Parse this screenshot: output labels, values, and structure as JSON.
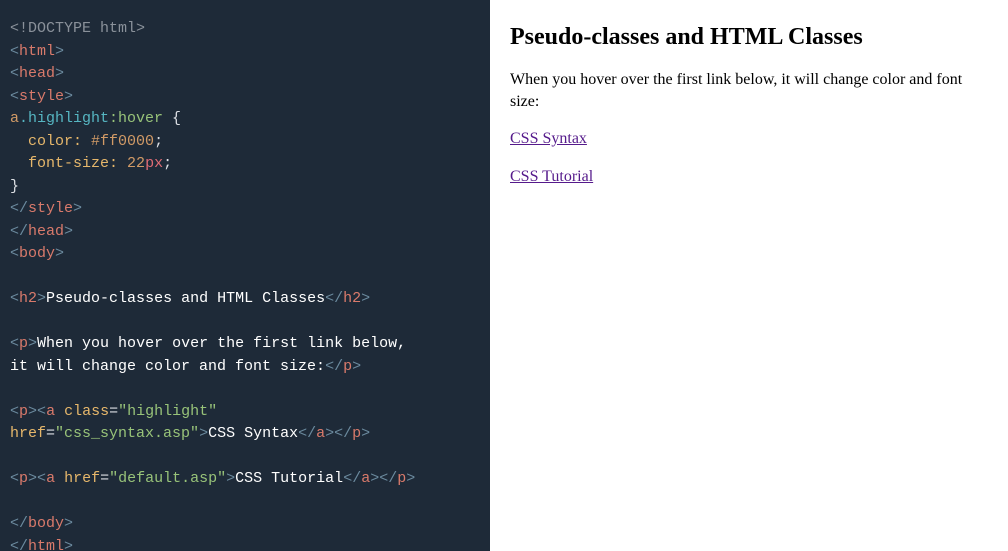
{
  "code": {
    "lines": [
      [
        {
          "cls": "c-gray",
          "t": "<!DOCTYPE html>"
        }
      ],
      [
        {
          "cls": "c-bracket",
          "t": "<"
        },
        {
          "cls": "c-tag",
          "t": "html"
        },
        {
          "cls": "c-bracket",
          "t": ">"
        }
      ],
      [
        {
          "cls": "c-bracket",
          "t": "<"
        },
        {
          "cls": "c-tag",
          "t": "head"
        },
        {
          "cls": "c-bracket",
          "t": ">"
        }
      ],
      [
        {
          "cls": "c-bracket",
          "t": "<"
        },
        {
          "cls": "c-tag",
          "t": "style"
        },
        {
          "cls": "c-bracket",
          "t": ">"
        }
      ],
      [
        {
          "cls": "c-seltag",
          "t": "a"
        },
        {
          "cls": "c-class",
          "t": ".highlight"
        },
        {
          "cls": "c-pseudo",
          "t": ":hover"
        },
        {
          "cls": "c-white",
          "t": " {"
        }
      ],
      [
        {
          "cls": "c-white",
          "t": "  "
        },
        {
          "cls": "c-prop",
          "t": "color:"
        },
        {
          "cls": "c-white",
          "t": " "
        },
        {
          "cls": "c-val",
          "t": "#ff0000"
        },
        {
          "cls": "c-white",
          "t": ";"
        }
      ],
      [
        {
          "cls": "c-white",
          "t": "  "
        },
        {
          "cls": "c-prop",
          "t": "font-size:"
        },
        {
          "cls": "c-white",
          "t": " "
        },
        {
          "cls": "c-val",
          "t": "22"
        },
        {
          "cls": "c-unit",
          "t": "px"
        },
        {
          "cls": "c-white",
          "t": ";"
        }
      ],
      [
        {
          "cls": "c-white",
          "t": "}"
        }
      ],
      [
        {
          "cls": "c-bracket",
          "t": "</"
        },
        {
          "cls": "c-tag",
          "t": "style"
        },
        {
          "cls": "c-bracket",
          "t": ">"
        }
      ],
      [
        {
          "cls": "c-bracket",
          "t": "</"
        },
        {
          "cls": "c-tag",
          "t": "head"
        },
        {
          "cls": "c-bracket",
          "t": ">"
        }
      ],
      [
        {
          "cls": "c-bracket",
          "t": "<"
        },
        {
          "cls": "c-tag",
          "t": "body"
        },
        {
          "cls": "c-bracket",
          "t": ">"
        }
      ],
      [
        {
          "cls": "",
          "t": " "
        }
      ],
      [
        {
          "cls": "c-bracket",
          "t": "<"
        },
        {
          "cls": "c-tag",
          "t": "h2"
        },
        {
          "cls": "c-bracket",
          "t": ">"
        },
        {
          "cls": "c-text",
          "t": "Pseudo-classes and HTML Classes"
        },
        {
          "cls": "c-bracket",
          "t": "</"
        },
        {
          "cls": "c-tag",
          "t": "h2"
        },
        {
          "cls": "c-bracket",
          "t": ">"
        }
      ],
      [
        {
          "cls": "",
          "t": " "
        }
      ],
      [
        {
          "cls": "c-bracket",
          "t": "<"
        },
        {
          "cls": "c-tag",
          "t": "p"
        },
        {
          "cls": "c-bracket",
          "t": ">"
        },
        {
          "cls": "c-text",
          "t": "When you hover over the first link below,"
        }
      ],
      [
        {
          "cls": "c-text",
          "t": "it will change color and font size:"
        },
        {
          "cls": "c-bracket",
          "t": "</"
        },
        {
          "cls": "c-tag",
          "t": "p"
        },
        {
          "cls": "c-bracket",
          "t": ">"
        }
      ],
      [
        {
          "cls": "",
          "t": " "
        }
      ],
      [
        {
          "cls": "c-bracket",
          "t": "<"
        },
        {
          "cls": "c-tag",
          "t": "p"
        },
        {
          "cls": "c-bracket",
          "t": ">"
        },
        {
          "cls": "c-bracket",
          "t": "<"
        },
        {
          "cls": "c-tag",
          "t": "a "
        },
        {
          "cls": "c-prop",
          "t": "class"
        },
        {
          "cls": "c-white",
          "t": "="
        },
        {
          "cls": "c-str",
          "t": "\"highlight\""
        }
      ],
      [
        {
          "cls": "c-prop",
          "t": "href"
        },
        {
          "cls": "c-white",
          "t": "="
        },
        {
          "cls": "c-str",
          "t": "\"css_syntax.asp\""
        },
        {
          "cls": "c-bracket",
          "t": ">"
        },
        {
          "cls": "c-text",
          "t": "CSS Syntax"
        },
        {
          "cls": "c-bracket",
          "t": "</"
        },
        {
          "cls": "c-tag",
          "t": "a"
        },
        {
          "cls": "c-bracket",
          "t": ">"
        },
        {
          "cls": "c-bracket",
          "t": "</"
        },
        {
          "cls": "c-tag",
          "t": "p"
        },
        {
          "cls": "c-bracket",
          "t": ">"
        }
      ],
      [
        {
          "cls": "",
          "t": " "
        }
      ],
      [
        {
          "cls": "c-bracket",
          "t": "<"
        },
        {
          "cls": "c-tag",
          "t": "p"
        },
        {
          "cls": "c-bracket",
          "t": ">"
        },
        {
          "cls": "c-bracket",
          "t": "<"
        },
        {
          "cls": "c-tag",
          "t": "a "
        },
        {
          "cls": "c-prop",
          "t": "href"
        },
        {
          "cls": "c-white",
          "t": "="
        },
        {
          "cls": "c-str",
          "t": "\"default.asp\""
        },
        {
          "cls": "c-bracket",
          "t": ">"
        },
        {
          "cls": "c-text",
          "t": "CSS Tutorial"
        },
        {
          "cls": "c-bracket",
          "t": "</"
        },
        {
          "cls": "c-tag",
          "t": "a"
        },
        {
          "cls": "c-bracket",
          "t": ">"
        },
        {
          "cls": "c-bracket",
          "t": "</"
        },
        {
          "cls": "c-tag",
          "t": "p"
        },
        {
          "cls": "c-bracket",
          "t": ">"
        }
      ],
      [
        {
          "cls": "",
          "t": " "
        }
      ],
      [
        {
          "cls": "c-bracket",
          "t": "</"
        },
        {
          "cls": "c-tag",
          "t": "body"
        },
        {
          "cls": "c-bracket",
          "t": ">"
        }
      ],
      [
        {
          "cls": "c-bracket",
          "t": "</"
        },
        {
          "cls": "c-tag",
          "t": "html"
        },
        {
          "cls": "c-bracket",
          "t": ">"
        }
      ]
    ]
  },
  "preview": {
    "heading": "Pseudo-classes and HTML Classes",
    "paragraph": "When you hover over the first link below, it will change color and font size:",
    "link1": "CSS Syntax",
    "link2": "CSS Tutorial"
  }
}
